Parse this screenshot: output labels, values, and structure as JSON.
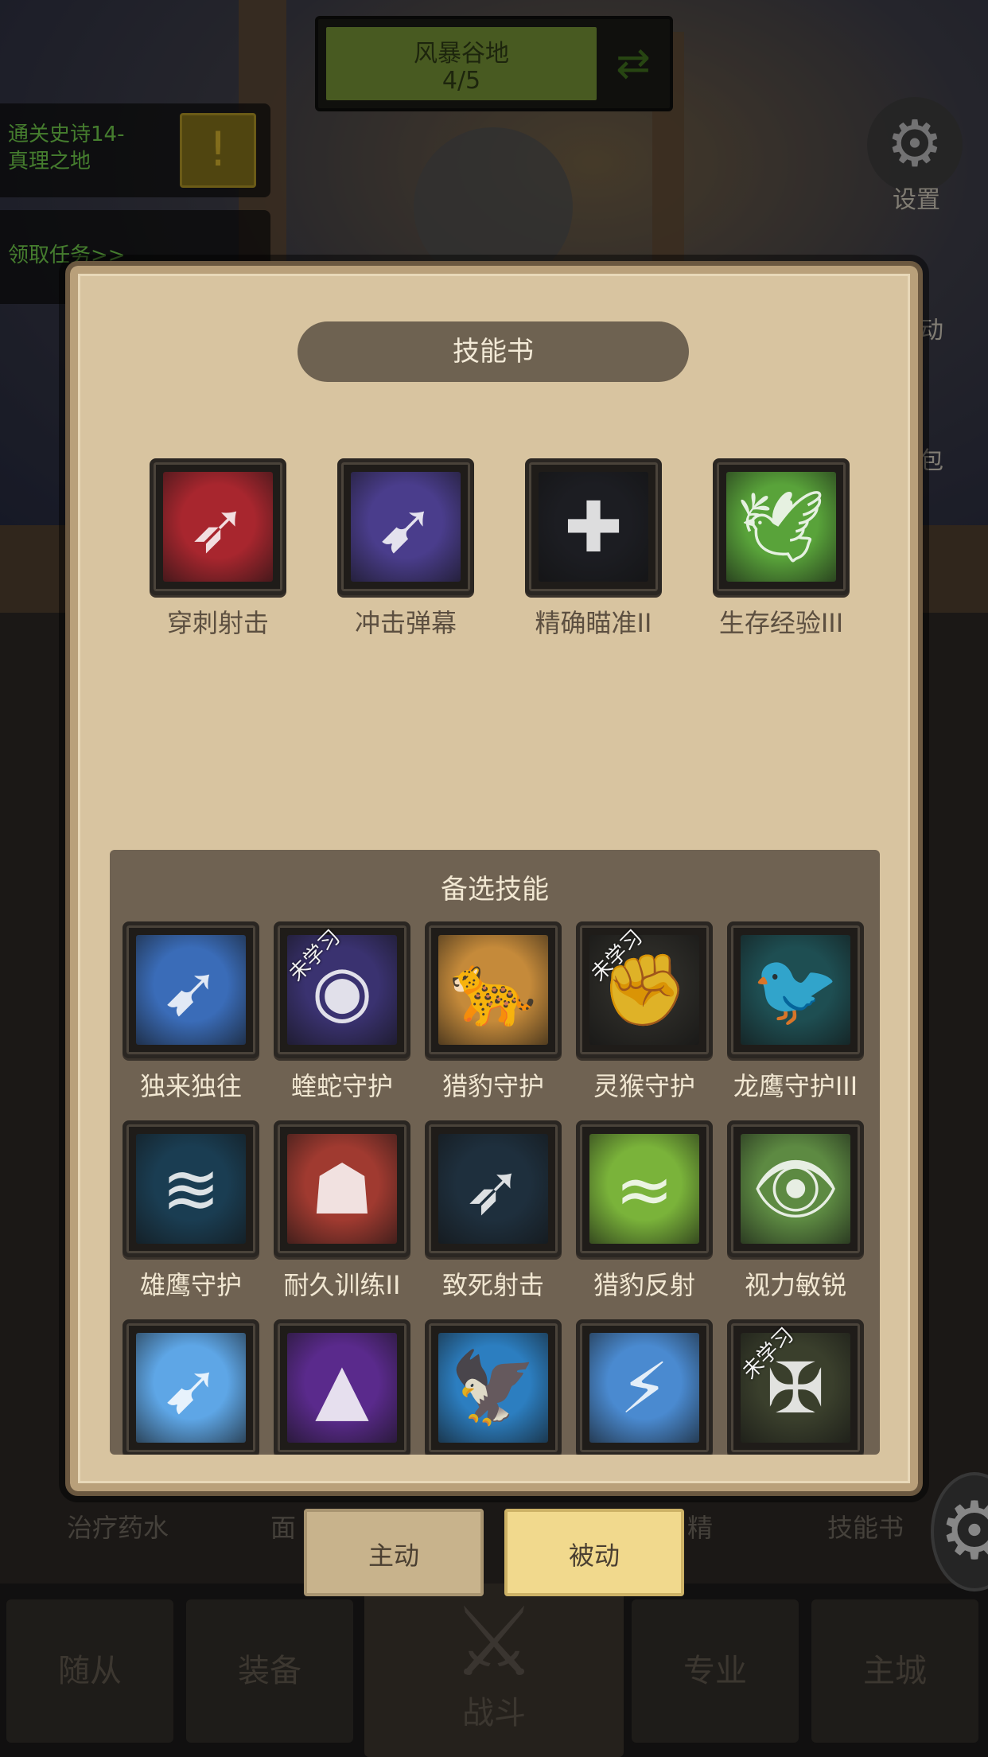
{
  "hud": {
    "stage_name": "风暴谷地",
    "stage_progress": "4/5",
    "quests": [
      {
        "text": "通关史诗14-\n真理之地"
      },
      {
        "text": "领取任务>>"
      }
    ],
    "side_menu": [
      {
        "label": "设置",
        "icon": "gear-icon"
      },
      {
        "label": "动",
        "icon": "event-icon"
      },
      {
        "label": "包",
        "icon": "bag-icon"
      }
    ]
  },
  "modal": {
    "title": "技能书",
    "equipped": [
      {
        "name": "穿刺射击",
        "icon": "piercing-arrow-icon",
        "color": "#a8262e"
      },
      {
        "name": "冲击弹幕",
        "icon": "arrow-barrage-icon",
        "color": "#4a3d8c"
      },
      {
        "name": "精确瞄准II",
        "icon": "crosshair-icon",
        "color": "#1c1d22"
      },
      {
        "name": "生存经验III",
        "icon": "eagle-icon",
        "color": "#59a33a"
      }
    ],
    "candidates_title": "备选技能",
    "candidates": [
      {
        "name": "独来独往",
        "icon": "spear-icon",
        "color": "#3a6cb8",
        "unlearned": false
      },
      {
        "name": "蝰蛇守护",
        "icon": "serpent-eye-icon",
        "color": "#3a3270",
        "unlearned": true
      },
      {
        "name": "猎豹守护",
        "icon": "cheetah-icon",
        "color": "#c58a3a",
        "unlearned": false
      },
      {
        "name": "灵猴守护",
        "icon": "monkey-fist-icon",
        "color": "#2b2a26",
        "unlearned": true
      },
      {
        "name": "龙鹰守护III",
        "icon": "dragonhawk-icon",
        "color": "#1e4e52",
        "unlearned": false
      },
      {
        "name": "雄鹰守护",
        "icon": "hawk-aura-icon",
        "color": "#1a3d52",
        "unlearned": false
      },
      {
        "name": "耐久训练II",
        "icon": "muscle-icon",
        "color": "#a03a30",
        "unlearned": false
      },
      {
        "name": "致死射击",
        "icon": "lethal-arrow-icon",
        "color": "#1e2f3d",
        "unlearned": false
      },
      {
        "name": "猎豹反射",
        "icon": "reflex-icon",
        "color": "#7ab33a",
        "unlearned": false
      },
      {
        "name": "视力敏锐",
        "icon": "eagle-eye-icon",
        "color": "#5d8a42",
        "unlearned": false
      },
      {
        "name": "",
        "icon": "wind-archer-icon",
        "color": "#5ea6e6",
        "unlearned": false
      },
      {
        "name": "",
        "icon": "arcane-arrow-icon",
        "color": "#5a2a8c",
        "unlearned": false
      },
      {
        "name": "",
        "icon": "eagle-strike-icon",
        "color": "#2c7ec0",
        "unlearned": false
      },
      {
        "name": "",
        "icon": "wind-shot-icon",
        "color": "#4a8ad0",
        "unlearned": false
      },
      {
        "name": "",
        "icon": "crossbow-icon",
        "color": "#3a3f2c",
        "unlearned": true
      }
    ],
    "unlearned_label": "未学习"
  },
  "tabs": {
    "active_label": "主动",
    "passive_label": "被动"
  },
  "quick_bar": [
    {
      "label": "治疗药水"
    },
    {
      "label": "面"
    },
    {
      "label": "精"
    },
    {
      "label": "技能书"
    }
  ],
  "bottom_nav": {
    "followers": "随从",
    "equipment": "装备",
    "battle": "战斗",
    "profession": "专业",
    "main_city": "主城"
  }
}
